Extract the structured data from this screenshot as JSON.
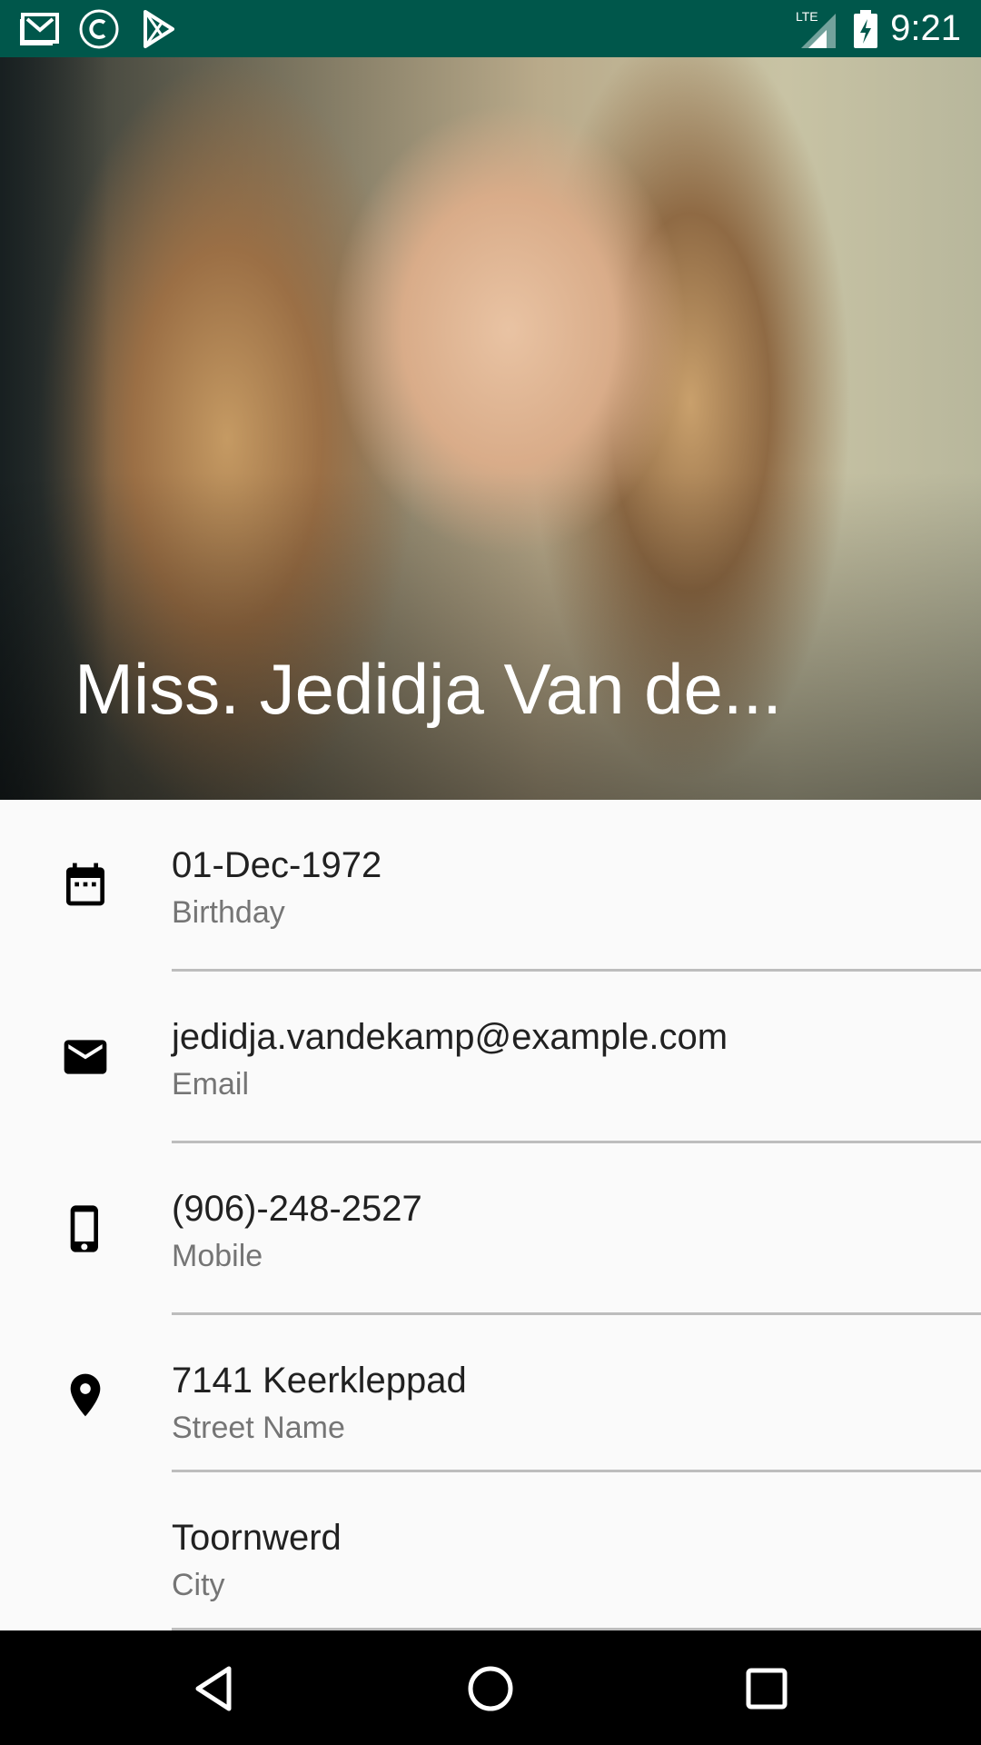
{
  "status_bar": {
    "time": "9:21",
    "network": "LTE",
    "left_icons": [
      "gmail-icon",
      "c-app-icon",
      "play-store-icon"
    ]
  },
  "header": {
    "title": "Miss. Jedidja Van de..."
  },
  "details": [
    {
      "icon": "calendar-icon",
      "value": "01-Dec-1972",
      "label": "Birthday"
    },
    {
      "icon": "email-icon",
      "value": "jedidja.vandekamp@example.com",
      "label": "Email"
    },
    {
      "icon": "phone-icon",
      "value": "(906)-248-2527",
      "label": "Mobile"
    },
    {
      "icon": "location-icon",
      "value": "7141 Keerkleppad",
      "label": "Street Name"
    },
    {
      "icon": "",
      "value": "Toornwerd",
      "label": "City"
    }
  ],
  "nav_bar": [
    "back-button",
    "home-button",
    "recents-button"
  ],
  "colors": {
    "status_bar": "#00574B",
    "background": "#FAFAFA",
    "primary_text": "#212121",
    "secondary_text": "#757575",
    "divider": "#BDBDBD"
  }
}
